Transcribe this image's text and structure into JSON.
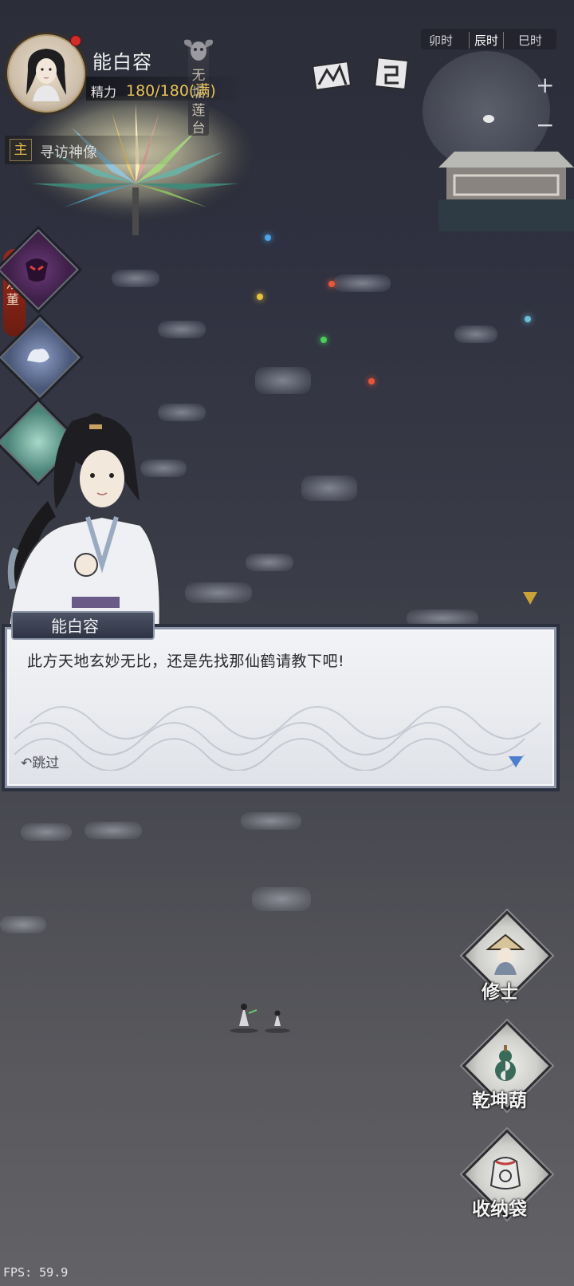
{
  "player": {
    "name": "能白容",
    "stamina_label": "精力",
    "stamina_value": "180/180(满)"
  },
  "location": {
    "sign_text": "无垢莲台"
  },
  "quest": {
    "tag": "主",
    "title": "寻访神像"
  },
  "time_bar": {
    "items": [
      "卯时",
      "辰时",
      "巳时"
    ]
  },
  "minimap": {
    "zoom_in": "+",
    "zoom_out": "−"
  },
  "side_tag": {
    "text": "观董"
  },
  "dialog": {
    "speaker": "能白容",
    "text": "此方天地玄妙无比，还是先找那仙鹤请教下吧!",
    "skip_label": "跳过"
  },
  "nav": {
    "items": [
      {
        "label": "修士",
        "icon": "straw-hat-cultivator-icon"
      },
      {
        "label": "乾坤葫",
        "icon": "gourd-icon"
      },
      {
        "label": "收纳袋",
        "icon": "storage-bag-icon"
      }
    ]
  },
  "fps": "FPS: 59.9",
  "colors": {
    "stamina": "#e8c25a",
    "red_dot": "#d42b2b",
    "next_arrow": "#4a7fd0",
    "quest_tag": "#e2b84a"
  }
}
